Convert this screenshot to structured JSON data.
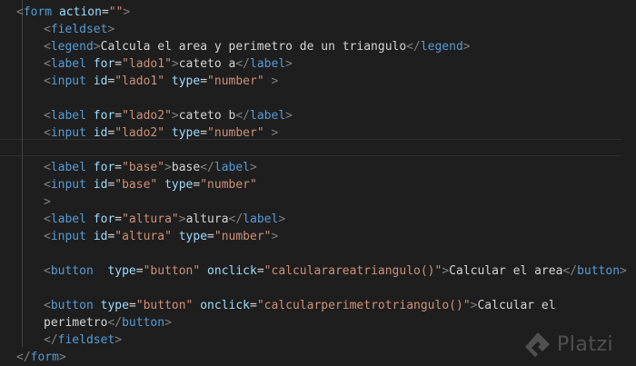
{
  "colors": {
    "background": "#1e1e1e",
    "tag": "#569cd6",
    "punct": "#808080",
    "attr": "#9cdcfe",
    "string": "#ce9178",
    "text": "#d4d4d4"
  },
  "code_lines": [
    {
      "indent": 0,
      "tokens": [
        [
          "punct",
          "<"
        ],
        [
          "tag",
          "form"
        ],
        [
          "txt",
          " "
        ],
        [
          "attr",
          "action"
        ],
        [
          "txt",
          "="
        ],
        [
          "str",
          "\"\""
        ],
        [
          "punct",
          ">"
        ]
      ]
    },
    {
      "indent": 1,
      "tokens": [
        [
          "punct",
          "<"
        ],
        [
          "tag",
          "fieldset"
        ],
        [
          "punct",
          ">"
        ]
      ]
    },
    {
      "indent": 1,
      "tokens": [
        [
          "punct",
          "<"
        ],
        [
          "tag",
          "legend"
        ],
        [
          "punct",
          ">"
        ],
        [
          "txt",
          "Calcula el area y perimetro de un triangulo"
        ],
        [
          "punct",
          "</"
        ],
        [
          "tag",
          "legend"
        ],
        [
          "punct",
          ">"
        ]
      ]
    },
    {
      "indent": 1,
      "tokens": [
        [
          "punct",
          "<"
        ],
        [
          "tag",
          "label"
        ],
        [
          "txt",
          " "
        ],
        [
          "attr",
          "for"
        ],
        [
          "txt",
          "="
        ],
        [
          "str",
          "\"lado1\""
        ],
        [
          "punct",
          ">"
        ],
        [
          "txt",
          "cateto a"
        ],
        [
          "punct",
          "</"
        ],
        [
          "tag",
          "label"
        ],
        [
          "punct",
          ">"
        ]
      ]
    },
    {
      "indent": 1,
      "tokens": [
        [
          "punct",
          "<"
        ],
        [
          "tag",
          "input"
        ],
        [
          "txt",
          " "
        ],
        [
          "attr",
          "id"
        ],
        [
          "txt",
          "="
        ],
        [
          "str",
          "\"lado1\""
        ],
        [
          "txt",
          " "
        ],
        [
          "attr",
          "type"
        ],
        [
          "txt",
          "="
        ],
        [
          "str",
          "\"number\""
        ],
        [
          "txt",
          " "
        ],
        [
          "punct",
          ">"
        ]
      ]
    },
    {
      "indent": 1,
      "tokens": []
    },
    {
      "indent": 1,
      "tokens": [
        [
          "punct",
          "<"
        ],
        [
          "tag",
          "label"
        ],
        [
          "txt",
          " "
        ],
        [
          "attr",
          "for"
        ],
        [
          "txt",
          "="
        ],
        [
          "str",
          "\"lado2\""
        ],
        [
          "punct",
          ">"
        ],
        [
          "txt",
          "cateto b"
        ],
        [
          "punct",
          "</"
        ],
        [
          "tag",
          "label"
        ],
        [
          "punct",
          ">"
        ]
      ]
    },
    {
      "indent": 1,
      "tokens": [
        [
          "punct",
          "<"
        ],
        [
          "tag",
          "input"
        ],
        [
          "txt",
          " "
        ],
        [
          "attr",
          "id"
        ],
        [
          "txt",
          "="
        ],
        [
          "str",
          "\"lado2\""
        ],
        [
          "txt",
          " "
        ],
        [
          "attr",
          "type"
        ],
        [
          "txt",
          "="
        ],
        [
          "str",
          "\"number\""
        ],
        [
          "txt",
          " "
        ],
        [
          "punct",
          ">"
        ]
      ]
    },
    {
      "indent": 1,
      "tokens": []
    },
    {
      "indent": 1,
      "tokens": [
        [
          "punct",
          "<"
        ],
        [
          "tag",
          "label"
        ],
        [
          "txt",
          " "
        ],
        [
          "attr",
          "for"
        ],
        [
          "txt",
          "="
        ],
        [
          "str",
          "\"base\""
        ],
        [
          "punct",
          ">"
        ],
        [
          "txt",
          "base"
        ],
        [
          "punct",
          "</"
        ],
        [
          "tag",
          "label"
        ],
        [
          "punct",
          ">"
        ]
      ]
    },
    {
      "indent": 1,
      "tokens": [
        [
          "punct",
          "<"
        ],
        [
          "tag",
          "input"
        ],
        [
          "txt",
          " "
        ],
        [
          "attr",
          "id"
        ],
        [
          "txt",
          "="
        ],
        [
          "str",
          "\"base\""
        ],
        [
          "txt",
          " "
        ],
        [
          "attr",
          "type"
        ],
        [
          "txt",
          "="
        ],
        [
          "str",
          "\"number\""
        ]
      ]
    },
    {
      "indent": 1,
      "tokens": [
        [
          "punct",
          ">"
        ]
      ]
    },
    {
      "indent": 1,
      "tokens": [
        [
          "punct",
          "<"
        ],
        [
          "tag",
          "label"
        ],
        [
          "txt",
          " "
        ],
        [
          "attr",
          "for"
        ],
        [
          "txt",
          "="
        ],
        [
          "str",
          "\"altura\""
        ],
        [
          "punct",
          ">"
        ],
        [
          "txt",
          "altura"
        ],
        [
          "punct",
          "</"
        ],
        [
          "tag",
          "label"
        ],
        [
          "punct",
          ">"
        ]
      ]
    },
    {
      "indent": 1,
      "tokens": [
        [
          "punct",
          "<"
        ],
        [
          "tag",
          "input"
        ],
        [
          "txt",
          " "
        ],
        [
          "attr",
          "id"
        ],
        [
          "txt",
          "="
        ],
        [
          "str",
          "\"altura\""
        ],
        [
          "txt",
          " "
        ],
        [
          "attr",
          "type"
        ],
        [
          "txt",
          "="
        ],
        [
          "str",
          "\"number\""
        ],
        [
          "punct",
          ">"
        ]
      ]
    },
    {
      "indent": 1,
      "tokens": []
    },
    {
      "indent": 1,
      "tokens": [
        [
          "punct",
          "<"
        ],
        [
          "tag",
          "button"
        ],
        [
          "txt",
          "  "
        ],
        [
          "attr",
          "type"
        ],
        [
          "txt",
          "="
        ],
        [
          "str",
          "\"button\""
        ],
        [
          "txt",
          " "
        ],
        [
          "attr",
          "onclick"
        ],
        [
          "txt",
          "="
        ],
        [
          "str",
          "\"calcularareatriangulo()\""
        ],
        [
          "punct",
          ">"
        ],
        [
          "txt",
          "Calcular el area"
        ],
        [
          "punct",
          "</"
        ],
        [
          "tag",
          "button"
        ],
        [
          "punct",
          ">"
        ]
      ]
    },
    {
      "indent": 1,
      "tokens": []
    },
    {
      "indent": 1,
      "tokens": [
        [
          "punct",
          "<"
        ],
        [
          "tag",
          "button"
        ],
        [
          "txt",
          " "
        ],
        [
          "attr",
          "type"
        ],
        [
          "txt",
          "="
        ],
        [
          "str",
          "\"button\""
        ],
        [
          "txt",
          " "
        ],
        [
          "attr",
          "onclick"
        ],
        [
          "txt",
          "="
        ],
        [
          "str",
          "\"calcularperimetrotriangulo()\""
        ],
        [
          "punct",
          ">"
        ],
        [
          "txt",
          "Calcular el"
        ]
      ]
    },
    {
      "indent": 1,
      "tokens": [
        [
          "txt",
          "perimetro"
        ],
        [
          "punct",
          "</"
        ],
        [
          "tag",
          "button"
        ],
        [
          "punct",
          ">"
        ]
      ]
    },
    {
      "indent": 1,
      "tokens": [
        [
          "punct",
          "</"
        ],
        [
          "tag",
          "fieldset"
        ],
        [
          "punct",
          ">"
        ]
      ]
    },
    {
      "indent": 0,
      "tokens": [
        [
          "punct",
          "</"
        ],
        [
          "tag",
          "form"
        ],
        [
          "punct",
          ">"
        ]
      ]
    }
  ],
  "watermark": {
    "text": "Platzi",
    "icon": "platzi-logo-icon"
  }
}
